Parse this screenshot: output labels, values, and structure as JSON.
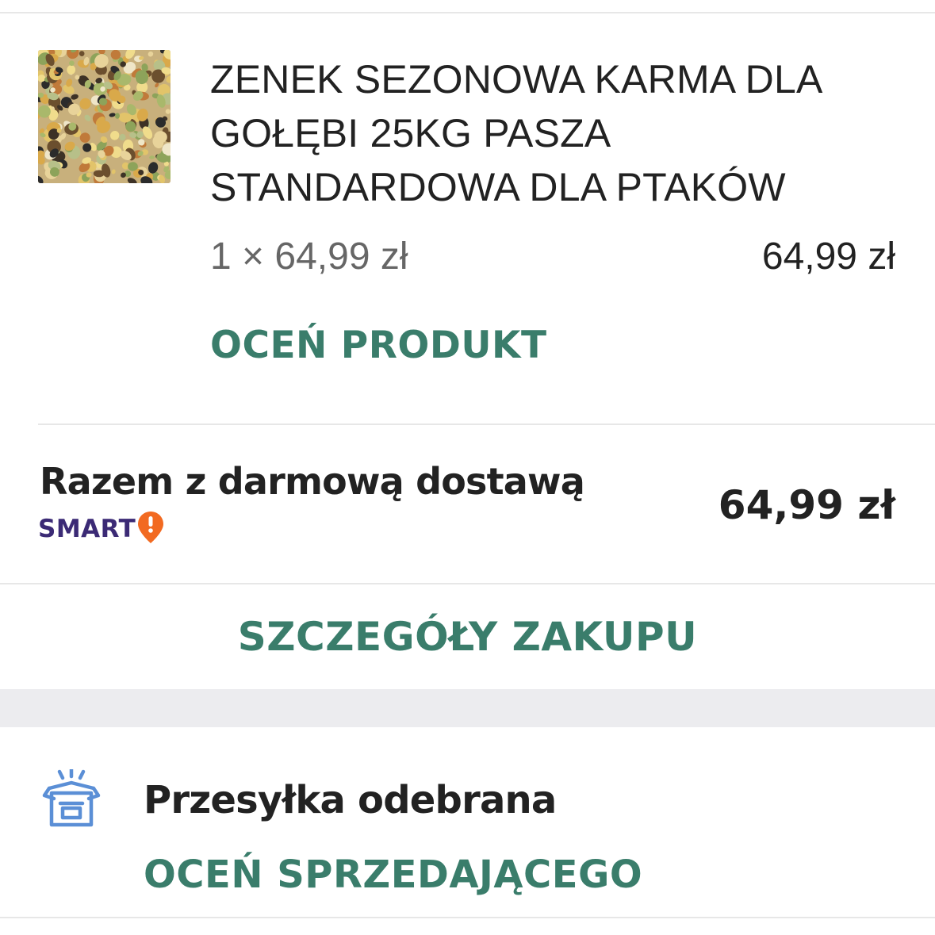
{
  "product": {
    "title": "ZENEK SEZONOWA KARMA DLA GOŁĘBI 25KG PASZA STANDARDOWA DLA PTAKÓW",
    "unit_price": "1 × 64,99 zł",
    "line_total": "64,99 zł",
    "rate_link": "OCEŃ PRODUKT",
    "image_icon": "pigeon-feed-photo"
  },
  "summary": {
    "total_label": "Razem z darmową dostawą",
    "total_value": "64,99 zł",
    "smart_logo_text": "SMART"
  },
  "details_link": "SZCZEGÓŁY ZAKUPU",
  "shipment": {
    "status": "Przesyłka odebrana",
    "rate_seller_link": "OCEŃ SPRZEDAJĄCEGO",
    "icon": "opened-box-icon"
  },
  "colors": {
    "accent_green": "#3a7d6b",
    "text_dark": "#222222",
    "text_gray": "#666666",
    "smart_purple": "#3b2a75",
    "smart_orange": "#f26a21",
    "divider": "#e7e7e7",
    "band": "#ececef"
  }
}
